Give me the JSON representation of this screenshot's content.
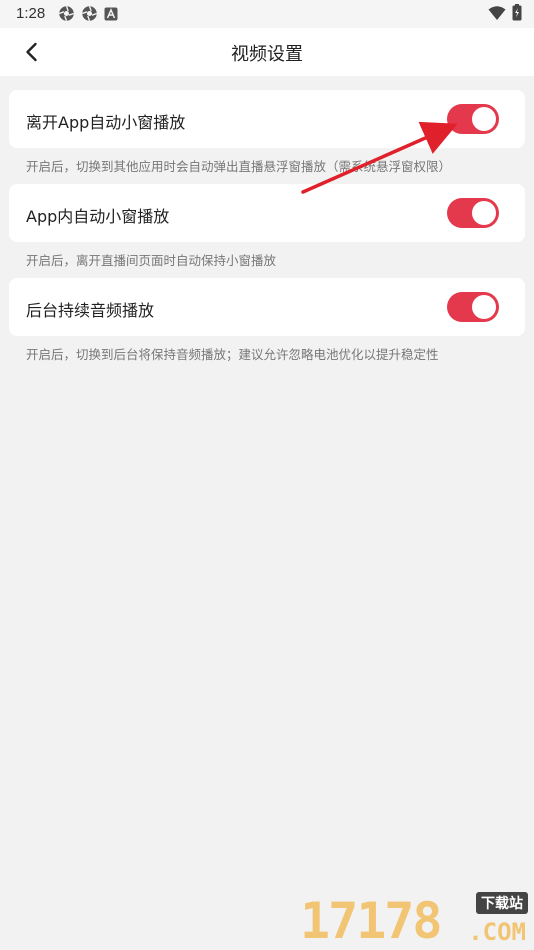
{
  "status_bar": {
    "time": "1:28",
    "left_icons": [
      "camera-shutter-icon",
      "camera-shutter-icon",
      "font-a-icon"
    ],
    "right_icons": [
      "wifi-icon",
      "battery-charging-icon"
    ]
  },
  "header": {
    "back_icon": "chevron-left-icon",
    "title": "视频设置"
  },
  "settings": [
    {
      "label": "离开App自动小窗播放",
      "enabled": true,
      "hint": "开启后，切换到其他应用时会自动弹出直播悬浮窗播放（需系统悬浮窗权限）"
    },
    {
      "label": "App内自动小窗播放",
      "enabled": true,
      "hint": "开启后，离开直播间页面时自动保持小窗播放"
    },
    {
      "label": "后台持续音频播放",
      "enabled": true,
      "hint": "开启后，切换到后台将保持音频播放；建议允许忽略电池优化以提升稳定性"
    }
  ],
  "colors": {
    "toggle_on": "#e4394d",
    "annotation_arrow": "#e0202a",
    "background": "#f2f2f2"
  },
  "watermark": {
    "digits": "17178",
    "badge": "下载站",
    "domain": ".COM"
  }
}
